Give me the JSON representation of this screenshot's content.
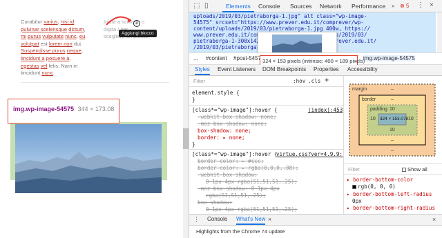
{
  "page": {
    "para_left": [
      "Curabitur ",
      "varius",
      ", ",
      "nisi id",
      " ",
      "pulvinar scelerisque",
      " ",
      "dictum",
      ", ",
      "mi",
      " ",
      "purus",
      " ",
      "vulputate",
      " ",
      "nunc",
      ", ",
      "eu volutpat",
      " est ",
      "lorem non",
      " dui. ",
      "Suspendisse purus",
      " ",
      "neque",
      ", ",
      "tincidunt a",
      " ",
      "posuere a",
      ", ",
      "egestas",
      " ",
      "vel",
      " felis. Nam in tincidunt ",
      "nunc",
      "."
    ],
    "para_right": [
      "Inizia a scrivere o",
      "digita / per",
      "scegliere un blocco"
    ],
    "tooltip": "Aggiungi blocco",
    "plus_glyph": "+",
    "img_tag": "img.wp-image-54575",
    "img_dim": "344 × 173.08"
  },
  "devtools": {
    "tabs": [
      "Elements",
      "Console",
      "Sources",
      "Network",
      "Performance"
    ],
    "active_tab": "Elements",
    "error_count": "5",
    "dom_lines": [
      "uploads/2019/03/pietraborga-1.jpg\" alt class=\"wp-image-",
      "54575\" srcset=\"https://www.prever.edu.it/comprever/wp-",
      "content/uploads/2019/03/pietraborga-1.jpg 400w, https://",
      "www.prever.edu.it/comprever/wp-content/uploads/2019/03/",
      "pietraborga-1-300x142.jpg 300w, https://www.prever.edu.it/",
      "                                 /2019/03/pietraborga-1-"
    ],
    "preview_size": "324 × 153 pixels (intrinsic: 400 × 189 pixels)",
    "breadcrumbs": [
      "...",
      "#content",
      "#post-5457",
      "img.wp-image-54575"
    ],
    "sidebar_tabs": [
      "Styles",
      "Event Listeners",
      "DOM Breakpoints",
      "Properties",
      "Accessibility"
    ],
    "filter_placeholder": "Filter",
    "filter_hov": ":hov",
    "filter_cls": ".cls",
    "filter_plus": "+",
    "styles": {
      "element_style": "element.style {",
      "close": "}",
      "rule1_sel": "[class*=\"wp-image\"]:hover {",
      "rule1_src": "(index):453",
      "rule1_props": [
        "-webkit-box-shadow: none;",
        "-moz-box-shadow: none;",
        "box-shadow: none;",
        "border: ▸ none;"
      ],
      "rule2_sel": "[class*=\"wp-image\"]:hover {",
      "rule2_src": "virtue.css?ver=4.9.9:1",
      "rule2_props": [
        "border-color: ▸ #ccc;",
        "border-color: ▸ rgba(0,0,0,.08);",
        "-webkit-box-shadow:",
        "0 1px 4px rgba(51,51,51,.25);",
        "-moz-box-shadow: 0 1px 4px",
        "rgba(51,51,51,.25);",
        "box-shadow:",
        "0 1px 4px rgba(51,51,51,.25);"
      ]
    },
    "boxmodel": {
      "margin_label": "margin",
      "border_label": "border",
      "padding_label": "padding",
      "dash": "–",
      "padding_val": "10",
      "content": "324 × 153.078"
    },
    "computed_filter": "Filter",
    "show_all": "Show all",
    "computed": [
      {
        "name": "border-bottom-color",
        "value": "rgb(0, 0, 0)"
      },
      {
        "name": "border-bottom-left-radius",
        "value": "0px"
      },
      {
        "name": "border-bottom-right-radius",
        "value": ""
      }
    ],
    "drawer_tabs": [
      "Console",
      "What's New"
    ],
    "drawer_close": "×",
    "drawer_text": "Highlights from the Chrome 74 update"
  },
  "colors": {
    "accent": "#1a73e8",
    "highlight_border": "#e1472e",
    "image_selection": "#c6dfb0"
  }
}
